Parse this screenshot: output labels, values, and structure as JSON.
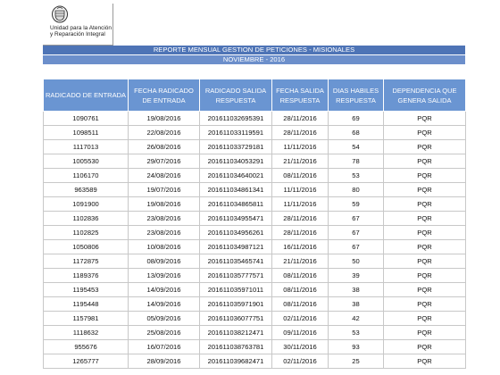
{
  "logo": {
    "line1": "Unidad para la Atención",
    "line2": "y Reparación Integral"
  },
  "report": {
    "title": "REPORTE MENSUAL GESTION DE PETICIONES - MISIONALES",
    "period": "NOVIEMBRE - 2016"
  },
  "table": {
    "columns": [
      "RADICADO DE ENTRADA",
      "FECHA RADICADO DE ENTRADA",
      "RADICADO SALIDA RESPUESTA",
      "FECHA SALIDA RESPUESTA",
      "DIAS HABILES RESPUESTA",
      "DEPENDENCIA QUE GENERA SALIDA"
    ],
    "rows": [
      [
        "1090761",
        "19/08/2016",
        "201611032695391",
        "28/11/2016",
        "69",
        "PQR"
      ],
      [
        "1098511",
        "22/08/2016",
        "201611033119591",
        "28/11/2016",
        "68",
        "PQR"
      ],
      [
        "1117013",
        "26/08/2016",
        "201611033729181",
        "11/11/2016",
        "54",
        "PQR"
      ],
      [
        "1005530",
        "29/07/2016",
        "201611034053291",
        "21/11/2016",
        "78",
        "PQR"
      ],
      [
        "1106170",
        "24/08/2016",
        "201611034640021",
        "08/11/2016",
        "53",
        "PQR"
      ],
      [
        "963589",
        "19/07/2016",
        "201611034861341",
        "11/11/2016",
        "80",
        "PQR"
      ],
      [
        "1091900",
        "19/08/2016",
        "201611034865811",
        "11/11/2016",
        "59",
        "PQR"
      ],
      [
        "1102836",
        "23/08/2016",
        "201611034955471",
        "28/11/2016",
        "67",
        "PQR"
      ],
      [
        "1102825",
        "23/08/2016",
        "201611034956261",
        "28/11/2016",
        "67",
        "PQR"
      ],
      [
        "1050806",
        "10/08/2016",
        "201611034987121",
        "16/11/2016",
        "67",
        "PQR"
      ],
      [
        "1172875",
        "08/09/2016",
        "201611035465741",
        "21/11/2016",
        "50",
        "PQR"
      ],
      [
        "1189376",
        "13/09/2016",
        "201611035777571",
        "08/11/2016",
        "39",
        "PQR"
      ],
      [
        "1195453",
        "14/09/2016",
        "201611035971011",
        "08/11/2016",
        "38",
        "PQR"
      ],
      [
        "1195448",
        "14/09/2016",
        "201611035971901",
        "08/11/2016",
        "38",
        "PQR"
      ],
      [
        "1157981",
        "05/09/2016",
        "201611036077751",
        "02/11/2016",
        "42",
        "PQR"
      ],
      [
        "1118632",
        "25/08/2016",
        "201611038212471",
        "09/11/2016",
        "53",
        "PQR"
      ],
      [
        "955676",
        "16/07/2016",
        "201611038763781",
        "30/11/2016",
        "93",
        "PQR"
      ],
      [
        "1265777",
        "28/09/2016",
        "201611039682471",
        "02/11/2016",
        "25",
        "PQR"
      ]
    ]
  }
}
